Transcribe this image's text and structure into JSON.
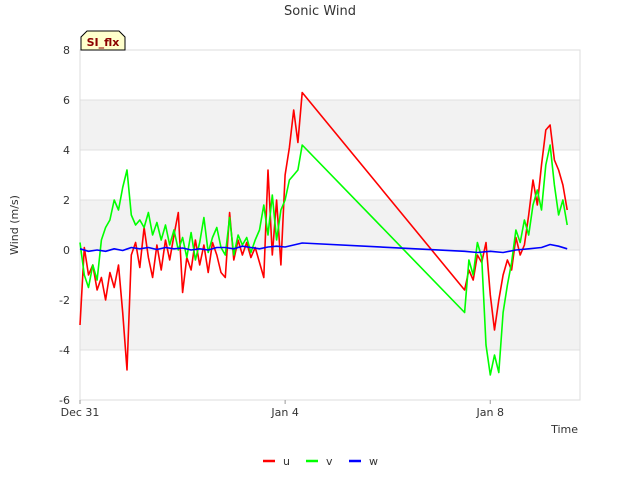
{
  "chart_data": {
    "type": "line",
    "title": "Sonic Wind",
    "xlabel": "Time",
    "ylabel": "Wind (m/s)",
    "badge": "SI_flx",
    "ylim": [
      -6,
      8
    ],
    "yticks": [
      -6,
      -4,
      -2,
      0,
      2,
      4,
      6,
      8
    ],
    "xlim": [
      "2023-12-31",
      "2024-01-09T18:00"
    ],
    "xticks": [
      {
        "value": "2023-12-31",
        "label": "Dec 31"
      },
      {
        "value": "2024-01-04",
        "label": "Jan 4"
      },
      {
        "value": "2024-01-08",
        "label": "Jan 8"
      }
    ],
    "grid": "horizontal bands",
    "legend_position": "bottom",
    "series": [
      {
        "name": "u",
        "color": "#ff0000",
        "points": [
          [
            "2023-12-31T00:00",
            -3.0
          ],
          [
            "2023-12-31T02:00",
            0.1
          ],
          [
            "2023-12-31T04:00",
            -1.0
          ],
          [
            "2023-12-31T06:00",
            -0.6
          ],
          [
            "2023-12-31T08:00",
            -1.6
          ],
          [
            "2023-12-31T10:00",
            -1.1
          ],
          [
            "2023-12-31T12:00",
            -2.0
          ],
          [
            "2023-12-31T14:00",
            -0.9
          ],
          [
            "2023-12-31T16:00",
            -1.5
          ],
          [
            "2023-12-31T18:00",
            -0.6
          ],
          [
            "2023-12-31T20:00",
            -2.5
          ],
          [
            "2023-12-31T22:00",
            -4.8
          ],
          [
            "2024-01-01T00:00",
            -0.2
          ],
          [
            "2024-01-01T02:00",
            0.3
          ],
          [
            "2024-01-01T04:00",
            -0.7
          ],
          [
            "2024-01-01T06:00",
            0.9
          ],
          [
            "2024-01-01T08:00",
            -0.3
          ],
          [
            "2024-01-01T10:00",
            -1.1
          ],
          [
            "2024-01-01T12:00",
            0.2
          ],
          [
            "2024-01-01T14:00",
            -0.8
          ],
          [
            "2024-01-01T16:00",
            0.4
          ],
          [
            "2024-01-01T18:00",
            -0.4
          ],
          [
            "2024-01-01T20:00",
            0.6
          ],
          [
            "2024-01-01T22:00",
            1.5
          ],
          [
            "2024-01-02T00:00",
            -1.7
          ],
          [
            "2024-01-02T02:00",
            -0.3
          ],
          [
            "2024-01-02T04:00",
            -0.8
          ],
          [
            "2024-01-02T06:00",
            0.4
          ],
          [
            "2024-01-02T08:00",
            -0.6
          ],
          [
            "2024-01-02T10:00",
            0.2
          ],
          [
            "2024-01-02T12:00",
            -0.9
          ],
          [
            "2024-01-02T14:00",
            0.3
          ],
          [
            "2024-01-02T16:00",
            -0.2
          ],
          [
            "2024-01-02T18:00",
            -0.9
          ],
          [
            "2024-01-02T20:00",
            -1.1
          ],
          [
            "2024-01-02T22:00",
            1.5
          ],
          [
            "2024-01-03T00:00",
            -0.4
          ],
          [
            "2024-01-03T02:00",
            0.4
          ],
          [
            "2024-01-03T04:00",
            -0.2
          ],
          [
            "2024-01-03T06:00",
            0.3
          ],
          [
            "2024-01-03T08:00",
            -0.3
          ],
          [
            "2024-01-03T10:00",
            0.1
          ],
          [
            "2024-01-03T12:00",
            -0.5
          ],
          [
            "2024-01-03T14:00",
            -1.1
          ],
          [
            "2024-01-03T16:00",
            3.2
          ],
          [
            "2024-01-03T18:00",
            -0.2
          ],
          [
            "2024-01-03T20:00",
            2.0
          ],
          [
            "2024-01-03T22:00",
            -0.6
          ],
          [
            "2024-01-04T00:00",
            3.0
          ],
          [
            "2024-01-04T02:00",
            4.1
          ],
          [
            "2024-01-04T04:00",
            5.6
          ],
          [
            "2024-01-04T06:00",
            4.3
          ],
          [
            "2024-01-04T08:00",
            6.3
          ],
          [
            "2024-01-07T12:00",
            -1.6
          ],
          [
            "2024-01-07T14:00",
            -0.8
          ],
          [
            "2024-01-07T16:00",
            -1.2
          ],
          [
            "2024-01-07T18:00",
            -0.2
          ],
          [
            "2024-01-07T20:00",
            -0.5
          ],
          [
            "2024-01-07T22:00",
            0.3
          ],
          [
            "2024-01-08T00:00",
            -1.8
          ],
          [
            "2024-01-08T02:00",
            -3.2
          ],
          [
            "2024-01-08T04:00",
            -2.0
          ],
          [
            "2024-01-08T06:00",
            -1.0
          ],
          [
            "2024-01-08T08:00",
            -0.4
          ],
          [
            "2024-01-08T10:00",
            -0.8
          ],
          [
            "2024-01-08T12:00",
            0.5
          ],
          [
            "2024-01-08T14:00",
            -0.2
          ],
          [
            "2024-01-08T16:00",
            0.2
          ],
          [
            "2024-01-08T18:00",
            1.4
          ],
          [
            "2024-01-08T20:00",
            2.8
          ],
          [
            "2024-01-08T22:00",
            1.8
          ],
          [
            "2024-01-09T00:00",
            3.4
          ],
          [
            "2024-01-09T02:00",
            4.8
          ],
          [
            "2024-01-09T04:00",
            5.0
          ],
          [
            "2024-01-09T06:00",
            3.6
          ],
          [
            "2024-01-09T08:00",
            3.2
          ],
          [
            "2024-01-09T10:00",
            2.6
          ],
          [
            "2024-01-09T12:00",
            1.6
          ]
        ]
      },
      {
        "name": "v",
        "color": "#00ff00",
        "points": [
          [
            "2023-12-31T00:00",
            0.3
          ],
          [
            "2023-12-31T02:00",
            -1.0
          ],
          [
            "2023-12-31T04:00",
            -1.5
          ],
          [
            "2023-12-31T06:00",
            -0.6
          ],
          [
            "2023-12-31T08:00",
            -1.2
          ],
          [
            "2023-12-31T10:00",
            0.4
          ],
          [
            "2023-12-31T12:00",
            0.9
          ],
          [
            "2023-12-31T14:00",
            1.2
          ],
          [
            "2023-12-31T16:00",
            2.0
          ],
          [
            "2023-12-31T18:00",
            1.6
          ],
          [
            "2023-12-31T20:00",
            2.5
          ],
          [
            "2023-12-31T22:00",
            3.2
          ],
          [
            "2024-01-01T00:00",
            1.4
          ],
          [
            "2024-01-01T02:00",
            1.0
          ],
          [
            "2024-01-01T04:00",
            1.2
          ],
          [
            "2024-01-01T06:00",
            0.9
          ],
          [
            "2024-01-01T08:00",
            1.5
          ],
          [
            "2024-01-01T10:00",
            0.6
          ],
          [
            "2024-01-01T12:00",
            1.1
          ],
          [
            "2024-01-01T14:00",
            0.4
          ],
          [
            "2024-01-01T16:00",
            1.0
          ],
          [
            "2024-01-01T18:00",
            0.2
          ],
          [
            "2024-01-01T20:00",
            0.8
          ],
          [
            "2024-01-01T22:00",
            0.0
          ],
          [
            "2024-01-02T00:00",
            0.5
          ],
          [
            "2024-01-02T02:00",
            -0.3
          ],
          [
            "2024-01-02T04:00",
            0.7
          ],
          [
            "2024-01-02T06:00",
            -0.4
          ],
          [
            "2024-01-02T08:00",
            0.3
          ],
          [
            "2024-01-02T10:00",
            1.3
          ],
          [
            "2024-01-02T12:00",
            -0.1
          ],
          [
            "2024-01-02T14:00",
            0.5
          ],
          [
            "2024-01-02T16:00",
            0.9
          ],
          [
            "2024-01-02T18:00",
            0.1
          ],
          [
            "2024-01-02T20:00",
            -0.2
          ],
          [
            "2024-01-02T22:00",
            1.3
          ],
          [
            "2024-01-03T00:00",
            -0.2
          ],
          [
            "2024-01-03T02:00",
            0.6
          ],
          [
            "2024-01-03T04:00",
            0.2
          ],
          [
            "2024-01-03T06:00",
            0.5
          ],
          [
            "2024-01-03T08:00",
            -0.1
          ],
          [
            "2024-01-03T10:00",
            0.4
          ],
          [
            "2024-01-03T12:00",
            0.8
          ],
          [
            "2024-01-03T14:00",
            1.8
          ],
          [
            "2024-01-03T16:00",
            0.6
          ],
          [
            "2024-01-03T18:00",
            2.2
          ],
          [
            "2024-01-03T20:00",
            0.4
          ],
          [
            "2024-01-03T22:00",
            1.6
          ],
          [
            "2024-01-04T00:00",
            2.0
          ],
          [
            "2024-01-04T02:00",
            2.8
          ],
          [
            "2024-01-04T04:00",
            3.0
          ],
          [
            "2024-01-04T06:00",
            3.2
          ],
          [
            "2024-01-04T08:00",
            4.2
          ],
          [
            "2024-01-07T12:00",
            -2.5
          ],
          [
            "2024-01-07T14:00",
            -0.4
          ],
          [
            "2024-01-07T16:00",
            -1.0
          ],
          [
            "2024-01-07T18:00",
            0.3
          ],
          [
            "2024-01-07T20:00",
            -0.3
          ],
          [
            "2024-01-07T22:00",
            -3.8
          ],
          [
            "2024-01-08T00:00",
            -5.0
          ],
          [
            "2024-01-08T02:00",
            -4.2
          ],
          [
            "2024-01-08T04:00",
            -4.9
          ],
          [
            "2024-01-08T06:00",
            -2.5
          ],
          [
            "2024-01-08T08:00",
            -1.4
          ],
          [
            "2024-01-08T10:00",
            -0.5
          ],
          [
            "2024-01-08T12:00",
            0.8
          ],
          [
            "2024-01-08T14:00",
            0.3
          ],
          [
            "2024-01-08T16:00",
            1.2
          ],
          [
            "2024-01-08T18:00",
            0.6
          ],
          [
            "2024-01-08T20:00",
            1.8
          ],
          [
            "2024-01-08T22:00",
            2.4
          ],
          [
            "2024-01-09T00:00",
            1.6
          ],
          [
            "2024-01-09T02:00",
            3.4
          ],
          [
            "2024-01-09T04:00",
            4.2
          ],
          [
            "2024-01-09T06:00",
            2.6
          ],
          [
            "2024-01-09T08:00",
            1.4
          ],
          [
            "2024-01-09T10:00",
            2.0
          ],
          [
            "2024-01-09T12:00",
            1.0
          ]
        ]
      },
      {
        "name": "w",
        "color": "#0000ff",
        "points": [
          [
            "2023-12-31T00:00",
            0.05
          ],
          [
            "2023-12-31T04:00",
            -0.05
          ],
          [
            "2023-12-31T08:00",
            0.0
          ],
          [
            "2023-12-31T12:00",
            -0.05
          ],
          [
            "2023-12-31T16:00",
            0.05
          ],
          [
            "2023-12-31T20:00",
            -0.02
          ],
          [
            "2024-01-01T00:00",
            0.1
          ],
          [
            "2024-01-01T04:00",
            0.05
          ],
          [
            "2024-01-01T08:00",
            0.1
          ],
          [
            "2024-01-01T12:00",
            0.02
          ],
          [
            "2024-01-01T16:00",
            0.1
          ],
          [
            "2024-01-01T20:00",
            0.05
          ],
          [
            "2024-01-02T00:00",
            0.08
          ],
          [
            "2024-01-02T04:00",
            0.0
          ],
          [
            "2024-01-02T08:00",
            0.05
          ],
          [
            "2024-01-02T12:00",
            0.0
          ],
          [
            "2024-01-02T16:00",
            0.1
          ],
          [
            "2024-01-02T20:00",
            0.1
          ],
          [
            "2024-01-03T00:00",
            0.05
          ],
          [
            "2024-01-03T04:00",
            0.15
          ],
          [
            "2024-01-03T08:00",
            0.1
          ],
          [
            "2024-01-03T12:00",
            0.05
          ],
          [
            "2024-01-03T16:00",
            0.12
          ],
          [
            "2024-01-03T20:00",
            0.15
          ],
          [
            "2024-01-04T00:00",
            0.12
          ],
          [
            "2024-01-04T04:00",
            0.2
          ],
          [
            "2024-01-04T08:00",
            0.28
          ],
          [
            "2024-01-07T12:00",
            -0.05
          ],
          [
            "2024-01-07T18:00",
            -0.1
          ],
          [
            "2024-01-08T00:00",
            -0.05
          ],
          [
            "2024-01-08T06:00",
            -0.1
          ],
          [
            "2024-01-08T12:00",
            0.0
          ],
          [
            "2024-01-08T18:00",
            0.05
          ],
          [
            "2024-01-09T00:00",
            0.1
          ],
          [
            "2024-01-09T04:00",
            0.22
          ],
          [
            "2024-01-09T08:00",
            0.15
          ],
          [
            "2024-01-09T12:00",
            0.05
          ]
        ]
      }
    ]
  }
}
